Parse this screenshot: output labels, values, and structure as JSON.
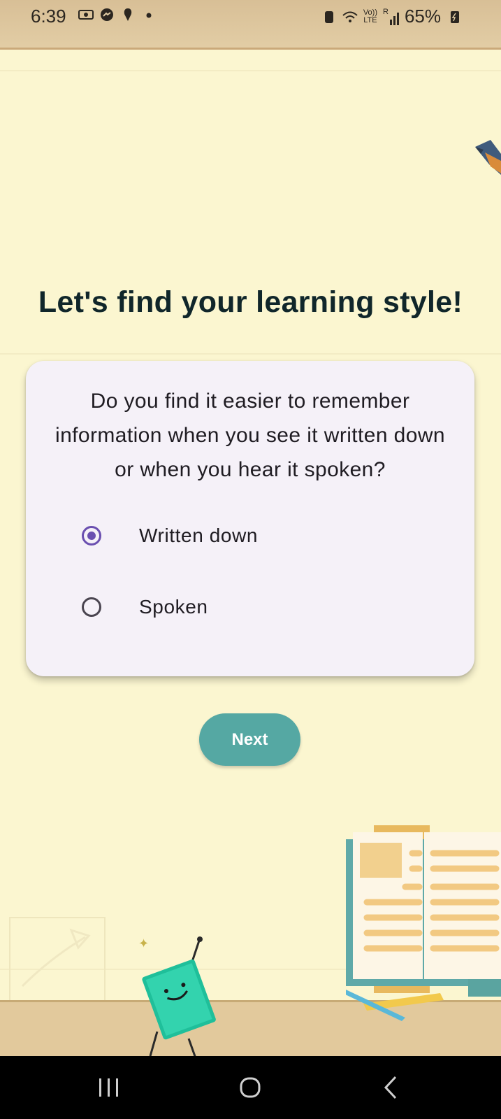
{
  "status_bar": {
    "time": "6:39",
    "battery_percent": "65%",
    "left_icons": [
      "recording-icon",
      "messenger-icon",
      "security-icon",
      "dot-icon"
    ],
    "right_icons": [
      "battery-saver-icon",
      "wifi-icon",
      "volte-icon",
      "signal-icon",
      "battery-icon"
    ],
    "network_label_top": "Vo))",
    "network_label_bottom": "LTE",
    "signal_label": "R"
  },
  "title": "Let's find your learning style!",
  "question": {
    "text": "Do you find it easier to remember information when you see it written down or when you hear it spoken?",
    "options": [
      {
        "label": "Written down",
        "selected": true
      },
      {
        "label": "Spoken",
        "selected": false
      }
    ]
  },
  "next_button": {
    "label": "Next"
  },
  "colors": {
    "background": "#fbf6d0",
    "accent": "#55a8a3",
    "radio_selected": "#6a4fb0",
    "title": "#10262a"
  },
  "nav_bar": {
    "items": [
      "recent-apps-icon",
      "home-icon",
      "back-icon"
    ]
  }
}
